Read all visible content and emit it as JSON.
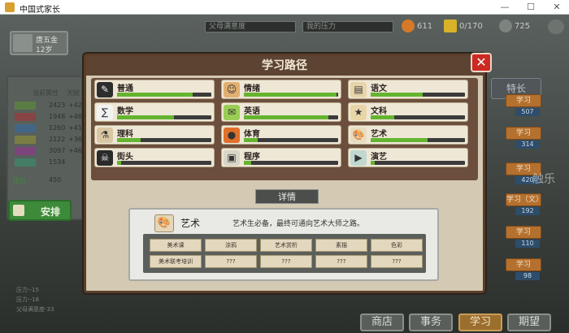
{
  "window": {
    "title": "中国式家长",
    "controls": [
      "—",
      "☐",
      "✕"
    ]
  },
  "hud": {
    "bars": [
      {
        "label": "父母满意度"
      },
      {
        "label": "我的压力"
      }
    ],
    "money": "611",
    "energy": "0/170",
    "points": "725"
  },
  "player": {
    "name": "唐五金",
    "age": "12岁"
  },
  "attributes": {
    "header_current": "当前属性",
    "header_gain": "天赋",
    "rows": [
      {
        "value": "2423",
        "delta": "+42/"
      },
      {
        "value": "1948",
        "delta": "+46/"
      },
      {
        "value": "1260",
        "delta": "+41/"
      },
      {
        "value": "2122",
        "delta": "+36/"
      },
      {
        "value": "3097",
        "delta": "+46/"
      },
      {
        "value": "1534",
        "delta": ""
      }
    ],
    "last_label": "压力",
    "last_value": "450"
  },
  "arrange": {
    "label": "安排"
  },
  "right": {
    "tech_label": "特长",
    "study_buttons": [
      {
        "label": "学习",
        "value": "507"
      },
      {
        "label": "学习",
        "value": "314"
      },
      {
        "label": "学习",
        "value": "420"
      },
      {
        "label": "学习（文）",
        "value": "192"
      },
      {
        "label": "学习",
        "value": "110"
      },
      {
        "label": "学习",
        "value": "98"
      }
    ]
  },
  "bottom_nav": [
    {
      "label": "商店",
      "active": false
    },
    {
      "label": "事务",
      "active": false
    },
    {
      "label": "学习",
      "active": true
    },
    {
      "label": "期望",
      "active": false
    }
  ],
  "bottom_left_lines": [
    "压力--15",
    "压力--18",
    "父母满意度-33"
  ],
  "watermark": "触乐",
  "modal": {
    "title": "学习路径",
    "close": "✕",
    "subjects": [
      {
        "label": "普通",
        "progress": 0.8,
        "icon": "general-icon",
        "color": "#2d2d2d"
      },
      {
        "label": "情绪",
        "progress": 0.98,
        "icon": "emotion-icon",
        "color": "#e0b070"
      },
      {
        "label": "语文",
        "progress": 0.55,
        "icon": "chinese-book-icon",
        "color": "#e7d5aa"
      },
      {
        "label": "数学",
        "progress": 0.6,
        "icon": "math-icon",
        "color": "#f2f2f2"
      },
      {
        "label": "英语",
        "progress": 0.9,
        "icon": "english-icon",
        "color": "#9acd55"
      },
      {
        "label": "文科",
        "progress": 0.25,
        "icon": "liberal-arts-icon",
        "color": "#e8d6a8"
      },
      {
        "label": "理科",
        "progress": 0.25,
        "icon": "science-icon",
        "color": "#d8c7a2"
      },
      {
        "label": "体育",
        "progress": 0.15,
        "icon": "basketball-icon",
        "color": "#e0702a"
      },
      {
        "label": "艺术",
        "progress": 0.6,
        "icon": "palette-icon",
        "color": "#e8dcc0"
      },
      {
        "label": "街头",
        "progress": 0.04,
        "icon": "street-icon",
        "color": "#2a2a2a"
      },
      {
        "label": "程序",
        "progress": 0.08,
        "icon": "computer-icon",
        "color": "#d9d4c8"
      },
      {
        "label": "演艺",
        "progress": 0.04,
        "icon": "performance-icon",
        "color": "#c0d8d0"
      }
    ],
    "detail_tag": "详情",
    "detail": {
      "name": "艺术",
      "description": "艺术生必备，最终可通向艺术大师之路。",
      "courses": [
        "美术课",
        "涂鸦",
        "艺术赏析",
        "素描",
        "色彩",
        "美术联考培训",
        "???",
        "???",
        "???",
        "???"
      ]
    }
  }
}
